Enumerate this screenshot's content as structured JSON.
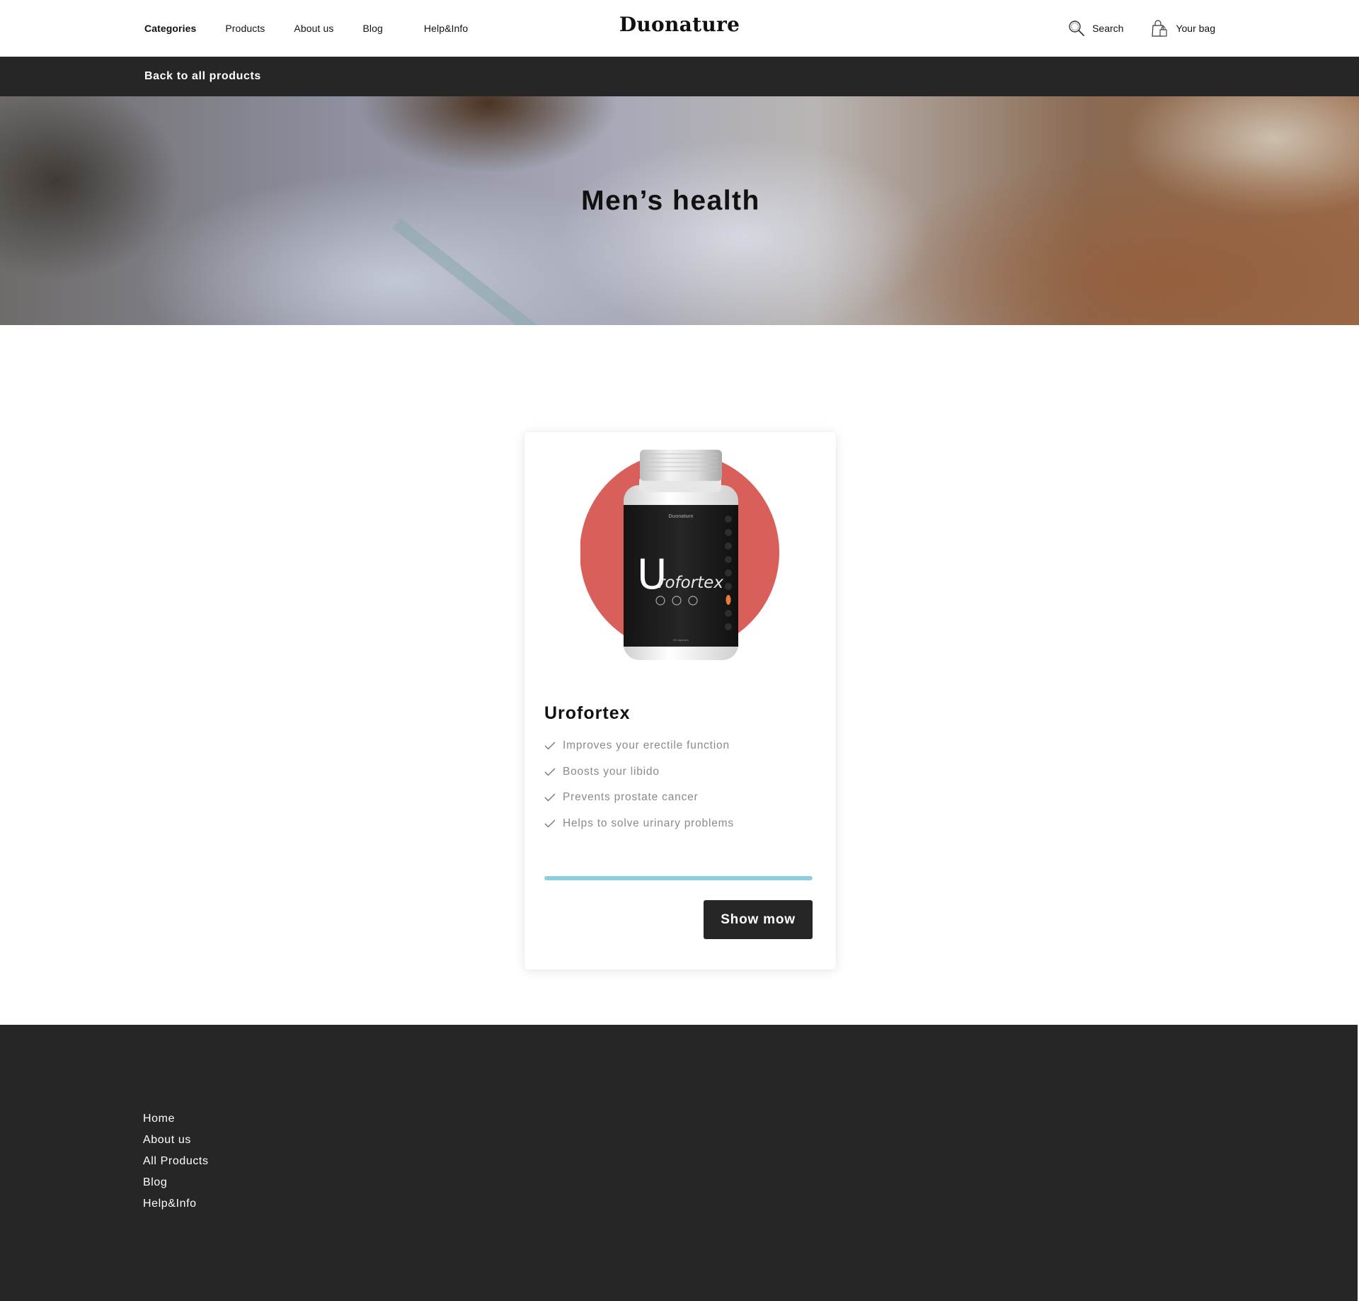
{
  "header": {
    "nav": [
      {
        "label": "Categories"
      },
      {
        "label": "Products"
      },
      {
        "label": "About us"
      },
      {
        "label": "Blog"
      },
      {
        "label": "Help&Info"
      }
    ],
    "logo": "Duonature",
    "search_label": "Search",
    "bag_label": "Your bag"
  },
  "backbar": {
    "label": "Back to all products"
  },
  "hero": {
    "title": "Men’s health"
  },
  "product": {
    "name": "Urofortex",
    "brand": "Duonature",
    "label_text": "rofortex",
    "label_initial": "U",
    "bottle_caption": "60 capsules",
    "features": [
      "Improves your erectile function",
      "Boosts your libido",
      "Prevents prostate cancer",
      "Helps to solve urinary problems"
    ],
    "progress_fraction": 1.0,
    "button_label": "Show mow",
    "circle_color": "#d9605a"
  },
  "footer": {
    "links": [
      "Home",
      "About us",
      "All Products",
      "Blog",
      "Help&Info"
    ]
  },
  "colors": {
    "dark": "#262626",
    "accent_progress": "#8dcfe2",
    "feature_text": "#8a8a8a"
  }
}
